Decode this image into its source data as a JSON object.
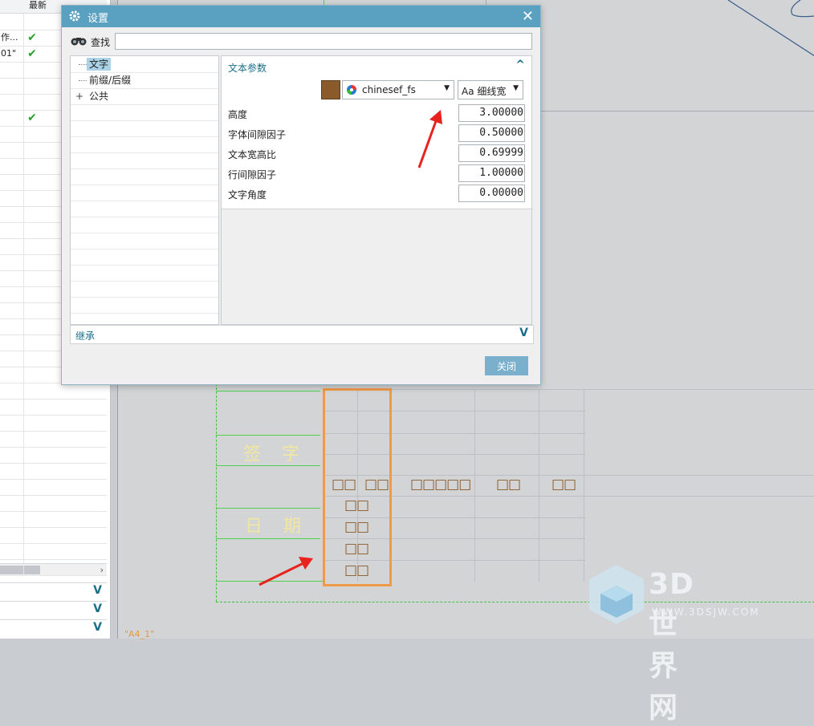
{
  "left_panel": {
    "header": "最新",
    "rows": [
      {
        "text": "",
        "check": ""
      },
      {
        "text": "作...",
        "check": "✔"
      },
      {
        "text": "01\"",
        "check": "✔"
      },
      {
        "text": "",
        "check": ""
      },
      {
        "text": "",
        "check": ""
      },
      {
        "text": "",
        "check": ""
      },
      {
        "text": "",
        "check": ""
      },
      {
        "text": "",
        "check": "✔"
      }
    ],
    "scroll_right": "›",
    "collapse_caret": "V"
  },
  "dialog": {
    "title": "设置",
    "close_glyph": "✕",
    "find_label": "查找",
    "find_value": "",
    "tree": [
      {
        "label": "文字",
        "selected": true,
        "expander": ""
      },
      {
        "label": "前缀/后缀",
        "selected": false,
        "expander": ""
      },
      {
        "label": "公共",
        "selected": false,
        "expander": "+"
      }
    ],
    "section_title": "文本参数",
    "section_caret": "^",
    "font_value": "chinesef_fs",
    "style_value": "Aa 细线宽",
    "dropdown_glyph": "▼",
    "params": [
      {
        "label": "高度",
        "value": "3.00000"
      },
      {
        "label": "字体间隙因子",
        "value": "0.50000"
      },
      {
        "label": "文本宽高比",
        "value": "0.69999"
      },
      {
        "label": "行间隙因子",
        "value": "1.00000"
      },
      {
        "label": "文字角度",
        "value": "0.00000"
      }
    ],
    "inherit_label": "继承",
    "inherit_caret": "V",
    "close_button": "关闭"
  },
  "drawing": {
    "sign_text": "签　字",
    "date_text": "日　期",
    "header_boxes": [
      "□□",
      "□□",
      "□□□□□",
      "□□",
      "□□"
    ],
    "col_boxes": [
      "□□",
      "□□",
      "□□",
      "□□"
    ],
    "bottom_label": "\"A4_1\""
  },
  "watermark": {
    "brand": "3D世界网",
    "url": "WWW.3DSJW.COM"
  },
  "colors": {
    "title_bar": "#5aa0c0",
    "accent_text": "#1a6e8a",
    "text_color_swatch": "#8a5a2a",
    "annotation_orange": "#f0994a",
    "arrow_red": "#e8231d"
  }
}
